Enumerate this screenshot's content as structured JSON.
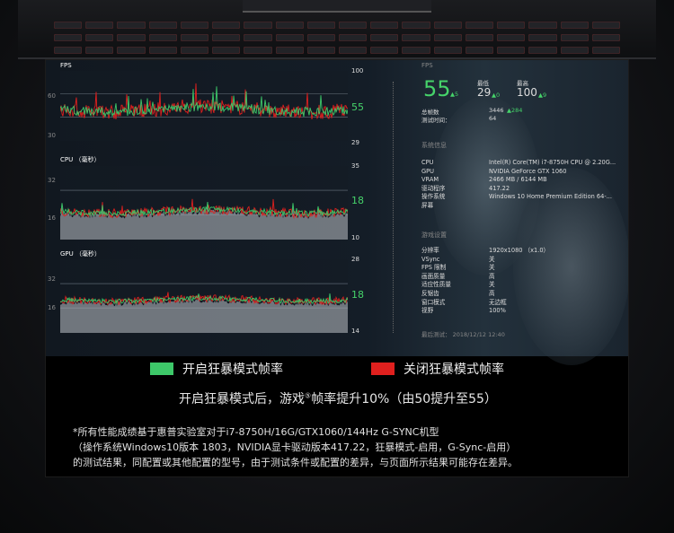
{
  "charts": {
    "fps": {
      "title": "FPS",
      "y_max": "100",
      "y_min": "29",
      "current": "55",
      "mid_label": "60",
      "low_label": "30"
    },
    "cpu": {
      "title": "CPU （毫秒）",
      "y_max": "35",
      "y_min": "10",
      "current": "18",
      "mid_label": "32",
      "low_label": "16"
    },
    "gpu": {
      "title": "GPU （毫秒）",
      "y_max": "28",
      "y_min": "14",
      "current": "18",
      "mid_label": "32",
      "low_label": "16"
    }
  },
  "info": {
    "fps_header": "FPS",
    "fps_value": "55",
    "fps_delta": "▲5",
    "min_label": "最低",
    "min_value": "29",
    "min_delta": "▲0",
    "max_label": "最高",
    "max_value": "100",
    "max_delta": "▲9",
    "frames_label": "总帧数",
    "frames_value": "3446",
    "frames_delta": "▲284",
    "time_label": "测试时间：",
    "time_value": "64",
    "system_header": "系统信息",
    "system": [
      {
        "k": "CPU",
        "v": "Intel(R) Core(TM) i7-8750H CPU @ 2.20G..."
      },
      {
        "k": "GPU",
        "v": "NVIDIA GeForce GTX 1060"
      },
      {
        "k": "VRAM",
        "v": "2466 MB / 6144 MB"
      },
      {
        "k": "驱动程序",
        "v": "417.22"
      },
      {
        "k": "操作系统",
        "v": "Windows 10 Home Premium Edition 64-..."
      },
      {
        "k": "屏幕",
        "v": ""
      }
    ],
    "game_header": "游戏设置",
    "settings": [
      {
        "k": "分辨率",
        "v": "1920x1080 （x1.0）"
      },
      {
        "k": "VSync",
        "v": "关"
      },
      {
        "k": "FPS 限制",
        "v": "关"
      },
      {
        "k": "画面质量",
        "v": "高"
      },
      {
        "k": "适应性质量",
        "v": "关"
      },
      {
        "k": "反锯齿",
        "v": "高"
      },
      {
        "k": "窗口模式",
        "v": "无边框"
      },
      {
        "k": "视野",
        "v": "100%"
      }
    ],
    "last_test": "最后测试： 2018/12/12 12:40"
  },
  "legend": {
    "on_label": "开启狂暴模式帧率",
    "off_label": "关闭狂暴模式帧率",
    "on_color": "#3dc869",
    "off_color": "#e0201e"
  },
  "headline": {
    "pre": "开启狂暴模式后，游戏",
    "sup": "⑤",
    "post": "帧率提升10%（由50提升至55）"
  },
  "disclaimer": [
    "*所有性能成绩基于惠普实验室对于i7-8750H/16G/GTX1060/144Hz G-SYNC机型",
    "（操作系统Windows10版本 1803，NVIDIA显卡驱动版本417.22，狂暴模式-启用，G-Sync-启用）",
    "的测试结果，同配置或其他配置的型号，由于测试条件或配置的差异，与页面所示结果可能存在差异。"
  ]
}
